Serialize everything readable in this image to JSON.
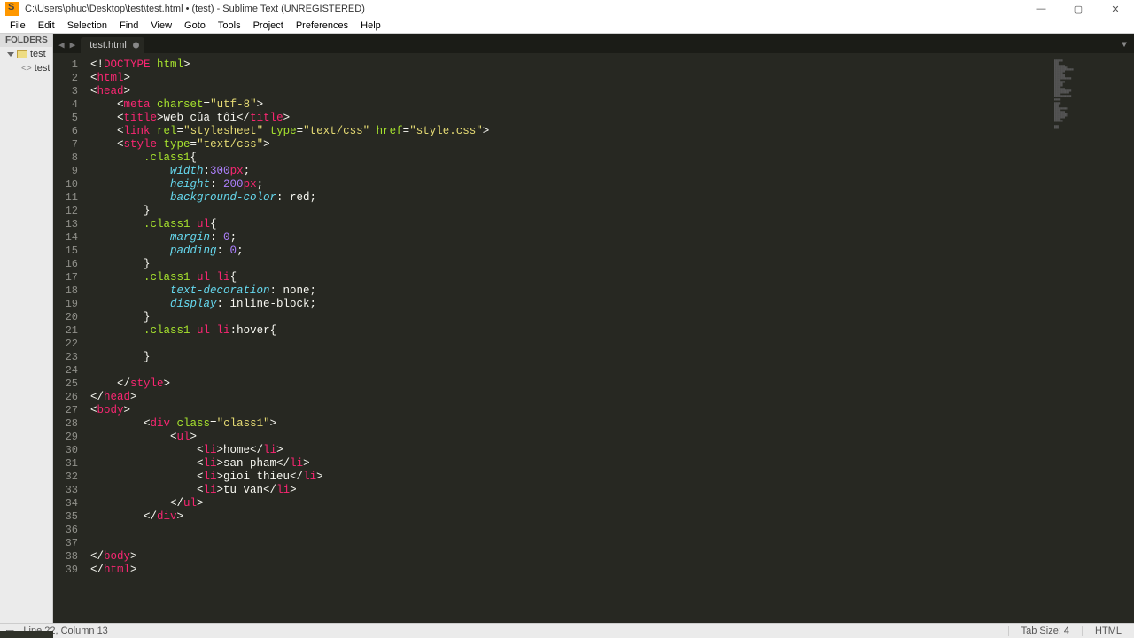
{
  "window": {
    "title": "C:\\Users\\phuc\\Desktop\\test\\test.html • (test) - Sublime Text (UNREGISTERED)"
  },
  "menu": [
    "File",
    "Edit",
    "Selection",
    "Find",
    "View",
    "Goto",
    "Tools",
    "Project",
    "Preferences",
    "Help"
  ],
  "sidebar": {
    "header": "FOLDERS",
    "folder": "test",
    "file": "test"
  },
  "tab": {
    "name": "test.html"
  },
  "status": {
    "left": "Line 22, Column 13",
    "tab_size": "Tab Size: 4",
    "syntax": "HTML"
  },
  "code": [
    {
      "n": 1
    },
    {
      "n": 2
    },
    {
      "n": 3
    },
    {
      "n": 4
    },
    {
      "n": 5
    },
    {
      "n": 6
    },
    {
      "n": 7
    },
    {
      "n": 8
    },
    {
      "n": 9
    },
    {
      "n": 10
    },
    {
      "n": 11
    },
    {
      "n": 12
    },
    {
      "n": 13
    },
    {
      "n": 14
    },
    {
      "n": 15
    },
    {
      "n": 16
    },
    {
      "n": 17
    },
    {
      "n": 18
    },
    {
      "n": 19
    },
    {
      "n": 20
    },
    {
      "n": 21
    },
    {
      "n": 22
    },
    {
      "n": 23
    },
    {
      "n": 24
    },
    {
      "n": 25
    },
    {
      "n": 26
    },
    {
      "n": 27
    },
    {
      "n": 28
    },
    {
      "n": 29
    },
    {
      "n": 30
    },
    {
      "n": 31
    },
    {
      "n": 32
    },
    {
      "n": 33
    },
    {
      "n": 34
    },
    {
      "n": 35
    },
    {
      "n": 36
    },
    {
      "n": 37
    },
    {
      "n": 38
    },
    {
      "n": 39
    }
  ],
  "tokens": {
    "l1": [
      [
        "p",
        "<!"
      ],
      [
        "kw",
        "DOCTYPE "
      ],
      [
        "at",
        "html"
      ],
      [
        "p",
        ">"
      ]
    ],
    "l2": [
      [
        "p",
        "<"
      ],
      [
        "kw",
        "html"
      ],
      [
        "p",
        ">"
      ]
    ],
    "l3": [
      [
        "p",
        "<"
      ],
      [
        "kw",
        "head"
      ],
      [
        "p",
        ">"
      ]
    ],
    "l4": [
      [
        "p",
        "    <"
      ],
      [
        "kw",
        "meta "
      ],
      [
        "at",
        "charset"
      ],
      [
        "p",
        "="
      ],
      [
        "s",
        "\"utf-8\""
      ],
      [
        "p",
        ">"
      ]
    ],
    "l5": [
      [
        "p",
        "    <"
      ],
      [
        "kw",
        "title"
      ],
      [
        "p",
        ">web của tôi</"
      ],
      [
        "kw",
        "title"
      ],
      [
        "p",
        ">"
      ]
    ],
    "l6": [
      [
        "p",
        "    <"
      ],
      [
        "kw",
        "link "
      ],
      [
        "at",
        "rel"
      ],
      [
        "p",
        "="
      ],
      [
        "s",
        "\"stylesheet\""
      ],
      [
        "p",
        " "
      ],
      [
        "at",
        "type"
      ],
      [
        "p",
        "="
      ],
      [
        "s",
        "\"text/css\""
      ],
      [
        "p",
        " "
      ],
      [
        "at",
        "href"
      ],
      [
        "p",
        "="
      ],
      [
        "s",
        "\"style.css\""
      ],
      [
        "p",
        ">"
      ]
    ],
    "l7": [
      [
        "p",
        "    <"
      ],
      [
        "kw",
        "style "
      ],
      [
        "at",
        "type"
      ],
      [
        "p",
        "="
      ],
      [
        "s",
        "\"text/css\""
      ],
      [
        "p",
        ">"
      ]
    ],
    "l8": [
      [
        "p",
        "        "
      ],
      [
        "sc",
        ".class1"
      ],
      [
        "p",
        "{"
      ]
    ],
    "l9": [
      [
        "p",
        "            "
      ],
      [
        "prop",
        "width"
      ],
      [
        "p",
        ":"
      ],
      [
        "const",
        "300"
      ],
      [
        "unit",
        "px"
      ],
      [
        "p",
        ";"
      ]
    ],
    "l10": [
      [
        "p",
        "            "
      ],
      [
        "prop",
        "height"
      ],
      [
        "p",
        ": "
      ],
      [
        "const",
        "200"
      ],
      [
        "unit",
        "px"
      ],
      [
        "p",
        ";"
      ]
    ],
    "l11": [
      [
        "p",
        "            "
      ],
      [
        "prop",
        "background-color"
      ],
      [
        "p",
        ": red;"
      ]
    ],
    "l12": [
      [
        "p",
        "        }"
      ]
    ],
    "l13": [
      [
        "p",
        "        "
      ],
      [
        "sc",
        ".class1 "
      ],
      [
        "sel",
        "ul"
      ],
      [
        "p",
        "{"
      ]
    ],
    "l14": [
      [
        "p",
        "            "
      ],
      [
        "prop",
        "margin"
      ],
      [
        "p",
        ": "
      ],
      [
        "const",
        "0"
      ],
      [
        "p",
        ";"
      ]
    ],
    "l15": [
      [
        "p",
        "            "
      ],
      [
        "prop",
        "padding"
      ],
      [
        "p",
        ": "
      ],
      [
        "const",
        "0"
      ],
      [
        "p",
        ";"
      ]
    ],
    "l16": [
      [
        "p",
        "        }"
      ]
    ],
    "l17": [
      [
        "p",
        "        "
      ],
      [
        "sc",
        ".class1 "
      ],
      [
        "sel",
        "ul "
      ],
      [
        "sel",
        "li"
      ],
      [
        "p",
        "{"
      ]
    ],
    "l18": [
      [
        "p",
        "            "
      ],
      [
        "prop",
        "text-decoration"
      ],
      [
        "p",
        ": none;"
      ]
    ],
    "l19": [
      [
        "p",
        "            "
      ],
      [
        "prop",
        "display"
      ],
      [
        "p",
        ": inline-block;"
      ]
    ],
    "l20": [
      [
        "p",
        "        }"
      ]
    ],
    "l21": [
      [
        "p",
        "        "
      ],
      [
        "sc",
        ".class1 "
      ],
      [
        "sel",
        "ul "
      ],
      [
        "sel",
        "li"
      ],
      [
        "p",
        ":hover{"
      ]
    ],
    "l22": [
      [
        "p",
        "            "
      ]
    ],
    "l23": [
      [
        "p",
        "        }"
      ]
    ],
    "l24": [
      [
        "p",
        ""
      ]
    ],
    "l25": [
      [
        "p",
        "    </"
      ],
      [
        "kw",
        "style"
      ],
      [
        "p",
        ">"
      ]
    ],
    "l26": [
      [
        "p",
        "</"
      ],
      [
        "kw",
        "head"
      ],
      [
        "p",
        ">"
      ]
    ],
    "l27": [
      [
        "p",
        "<"
      ],
      [
        "kw",
        "body"
      ],
      [
        "p",
        ">"
      ]
    ],
    "l28": [
      [
        "p",
        "        <"
      ],
      [
        "kw",
        "div "
      ],
      [
        "at",
        "class"
      ],
      [
        "p",
        "="
      ],
      [
        "s",
        "\"class1\""
      ],
      [
        "p",
        ">"
      ]
    ],
    "l29": [
      [
        "p",
        "            <"
      ],
      [
        "kw",
        "ul"
      ],
      [
        "p",
        ">"
      ]
    ],
    "l30": [
      [
        "p",
        "                <"
      ],
      [
        "kw",
        "li"
      ],
      [
        "p",
        ">home</"
      ],
      [
        "kw",
        "li"
      ],
      [
        "p",
        ">"
      ]
    ],
    "l31": [
      [
        "p",
        "                <"
      ],
      [
        "kw",
        "li"
      ],
      [
        "p",
        ">san pham</"
      ],
      [
        "kw",
        "li"
      ],
      [
        "p",
        ">"
      ]
    ],
    "l32": [
      [
        "p",
        "                <"
      ],
      [
        "kw",
        "li"
      ],
      [
        "p",
        ">gioi thieu</"
      ],
      [
        "kw",
        "li"
      ],
      [
        "p",
        ">"
      ]
    ],
    "l33": [
      [
        "p",
        "                <"
      ],
      [
        "kw",
        "li"
      ],
      [
        "p",
        ">tu van</"
      ],
      [
        "kw",
        "li"
      ],
      [
        "p",
        ">"
      ]
    ],
    "l34": [
      [
        "p",
        "            </"
      ],
      [
        "kw",
        "ul"
      ],
      [
        "p",
        ">"
      ]
    ],
    "l35": [
      [
        "p",
        "        </"
      ],
      [
        "kw",
        "div"
      ],
      [
        "p",
        ">"
      ]
    ],
    "l36": [
      [
        "p",
        ""
      ]
    ],
    "l37": [
      [
        "p",
        ""
      ]
    ],
    "l38": [
      [
        "p",
        "</"
      ],
      [
        "kw",
        "body"
      ],
      [
        "p",
        ">"
      ]
    ],
    "l39": [
      [
        "p",
        "</"
      ],
      [
        "kw",
        "html"
      ],
      [
        "p",
        ">"
      ]
    ]
  }
}
